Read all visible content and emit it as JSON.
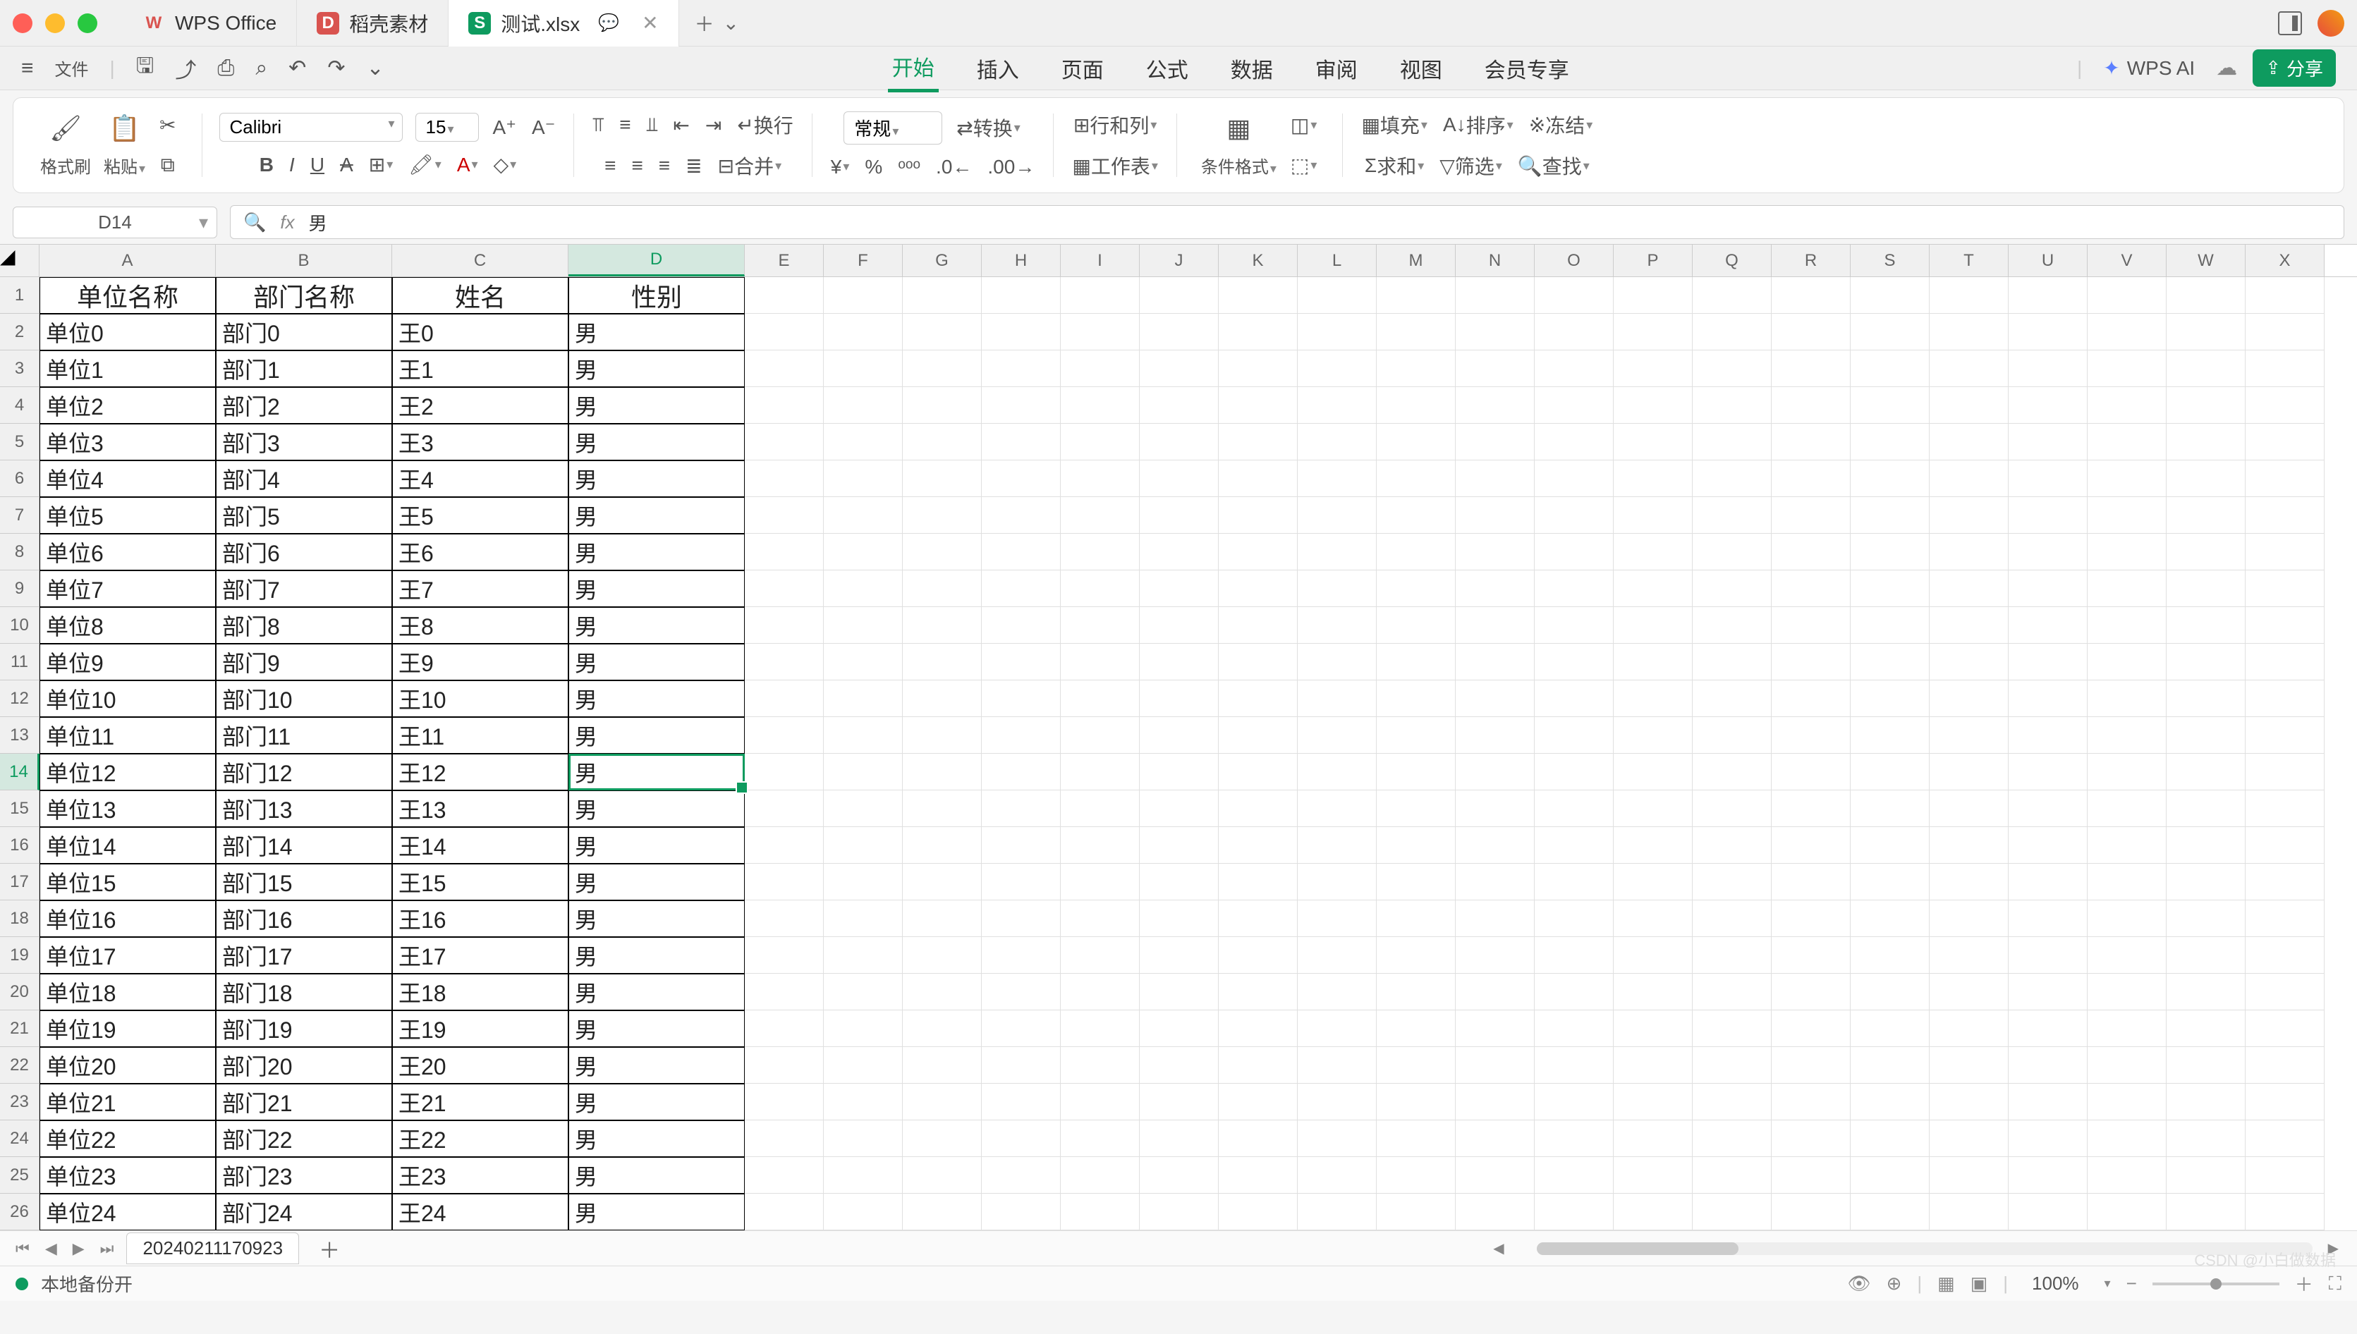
{
  "titlebar": {
    "tabs": [
      {
        "icon": "W",
        "label": "WPS Office",
        "iconClass": "wps"
      },
      {
        "icon": "D",
        "label": "稻壳素材",
        "iconClass": "dao"
      },
      {
        "icon": "S",
        "label": "测试.xlsx",
        "iconClass": "sheet",
        "active": true
      }
    ],
    "new_tab_plus": "＋",
    "new_tab_chev": "⌄"
  },
  "quickbar": {
    "menu_file": "文件",
    "menus": [
      "开始",
      "插入",
      "页面",
      "公式",
      "数据",
      "审阅",
      "视图",
      "会员专享"
    ],
    "active_menu": "开始",
    "wps_ai": "WPS AI",
    "share": "分享"
  },
  "ribbon": {
    "format_painter": "格式刷",
    "paste": "粘贴",
    "font_name": "Calibri",
    "font_size": "15",
    "wrap_text": "换行",
    "merge": "合并",
    "num_format": "常规",
    "convert": "转换",
    "rows_cols": "行和列",
    "worksheet": "工作表",
    "cond_format": "条件格式",
    "fill": "填充",
    "sort": "排序",
    "sum": "求和",
    "filter": "筛选",
    "freeze": "冻结",
    "find": "查找"
  },
  "formula_bar": {
    "name_box": "D14",
    "fx_value": "男"
  },
  "column_widths": {
    "A": 250,
    "B": 250,
    "C": 250,
    "D": 250,
    "other": 112
  },
  "columns": [
    "A",
    "B",
    "C",
    "D",
    "E",
    "F",
    "G",
    "H",
    "I",
    "J",
    "K",
    "L",
    "M",
    "N",
    "O",
    "P",
    "Q",
    "R",
    "S",
    "T",
    "U",
    "V",
    "W",
    "X"
  ],
  "selected_col": "D",
  "selected_row": 14,
  "headers": [
    "单位名称",
    "部门名称",
    "姓名",
    "性别"
  ],
  "rows": [
    {
      "n": 1,
      "h": true
    },
    {
      "n": 2,
      "v": [
        "单位0",
        "部门0",
        "王0",
        "男"
      ]
    },
    {
      "n": 3,
      "v": [
        "单位1",
        "部门1",
        "王1",
        "男"
      ]
    },
    {
      "n": 4,
      "v": [
        "单位2",
        "部门2",
        "王2",
        "男"
      ]
    },
    {
      "n": 5,
      "v": [
        "单位3",
        "部门3",
        "王3",
        "男"
      ]
    },
    {
      "n": 6,
      "v": [
        "单位4",
        "部门4",
        "王4",
        "男"
      ]
    },
    {
      "n": 7,
      "v": [
        "单位5",
        "部门5",
        "王5",
        "男"
      ]
    },
    {
      "n": 8,
      "v": [
        "单位6",
        "部门6",
        "王6",
        "男"
      ]
    },
    {
      "n": 9,
      "v": [
        "单位7",
        "部门7",
        "王7",
        "男"
      ]
    },
    {
      "n": 10,
      "v": [
        "单位8",
        "部门8",
        "王8",
        "男"
      ]
    },
    {
      "n": 11,
      "v": [
        "单位9",
        "部门9",
        "王9",
        "男"
      ]
    },
    {
      "n": 12,
      "v": [
        "单位10",
        "部门10",
        "王10",
        "男"
      ]
    },
    {
      "n": 13,
      "v": [
        "单位11",
        "部门11",
        "王11",
        "男"
      ]
    },
    {
      "n": 14,
      "v": [
        "单位12",
        "部门12",
        "王12",
        "男"
      ]
    },
    {
      "n": 15,
      "v": [
        "单位13",
        "部门13",
        "王13",
        "男"
      ]
    },
    {
      "n": 16,
      "v": [
        "单位14",
        "部门14",
        "王14",
        "男"
      ]
    },
    {
      "n": 17,
      "v": [
        "单位15",
        "部门15",
        "王15",
        "男"
      ]
    },
    {
      "n": 18,
      "v": [
        "单位16",
        "部门16",
        "王16",
        "男"
      ]
    },
    {
      "n": 19,
      "v": [
        "单位17",
        "部门17",
        "王17",
        "男"
      ]
    },
    {
      "n": 20,
      "v": [
        "单位18",
        "部门18",
        "王18",
        "男"
      ]
    },
    {
      "n": 21,
      "v": [
        "单位19",
        "部门19",
        "王19",
        "男"
      ]
    },
    {
      "n": 22,
      "v": [
        "单位20",
        "部门20",
        "王20",
        "男"
      ]
    },
    {
      "n": 23,
      "v": [
        "单位21",
        "部门21",
        "王21",
        "男"
      ]
    },
    {
      "n": 24,
      "v": [
        "单位22",
        "部门22",
        "王22",
        "男"
      ]
    },
    {
      "n": 25,
      "v": [
        "单位23",
        "部门23",
        "王23",
        "男"
      ]
    },
    {
      "n": 26,
      "v": [
        "单位24",
        "部门24",
        "王24",
        "男"
      ]
    }
  ],
  "sheet_tabs": {
    "sheet_name": "20240211170923"
  },
  "statusbar": {
    "backup": "本地备份开",
    "zoom": "100%"
  },
  "watermark": "CSDN @小白做数据"
}
